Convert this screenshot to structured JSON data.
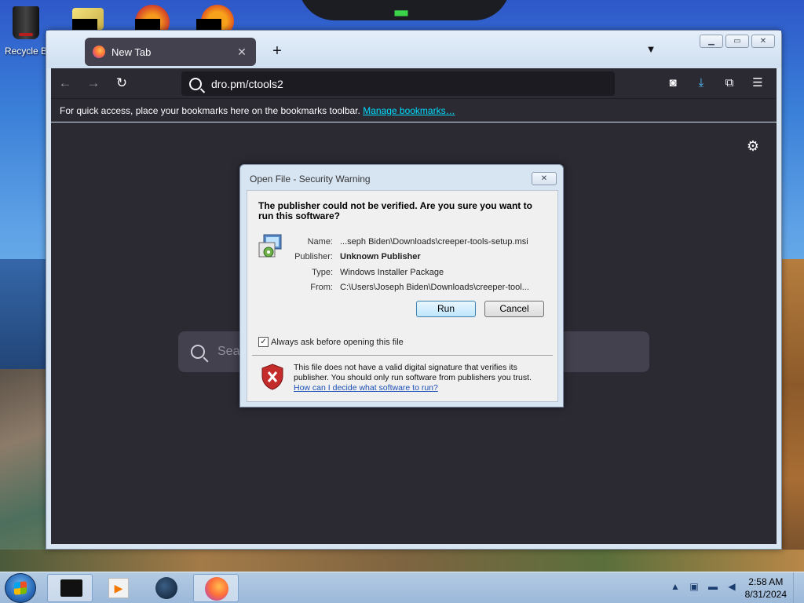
{
  "desktop": {
    "recycle_bin_label": "Recycle B"
  },
  "browser": {
    "tab_title": "New Tab",
    "url": "dro.pm/ctools2",
    "bookmarks_message": "For quick access, place your bookmarks here on the bookmarks toolbar.",
    "bookmarks_link": "Manage bookmarks…",
    "search_placeholder": "Sea"
  },
  "dialog": {
    "title": "Open File - Security Warning",
    "heading": "The publisher could not be verified.  Are you sure you want to run this software?",
    "properties": [
      {
        "key": "Name:",
        "value": "...seph Biden\\Downloads\\creeper-tools-setup.msi",
        "bold": false
      },
      {
        "key": "Publisher:",
        "value": "Unknown Publisher",
        "bold": true
      },
      {
        "key": "Type:",
        "value": "Windows Installer Package",
        "bold": false
      },
      {
        "key": "From:",
        "value": "C:\\Users\\Joseph Biden\\Downloads\\creeper-tool...",
        "bold": false
      }
    ],
    "run_label": "Run",
    "cancel_label": "Cancel",
    "checkbox_label": "Always ask before opening this file",
    "checkbox_checked": true,
    "warning_text": "This file does not have a valid digital signature that verifies its publisher.  You should only run software from publishers you trust.",
    "warning_link": "How can I decide what software to run?"
  },
  "taskbar": {
    "time": "2:58 AM",
    "date": "8/31/2024"
  },
  "colors": {
    "browser_chrome": "#2b2a33",
    "url_bg": "#1c1b22",
    "link": "#00ddff",
    "download_accent": "#54c7ff"
  }
}
